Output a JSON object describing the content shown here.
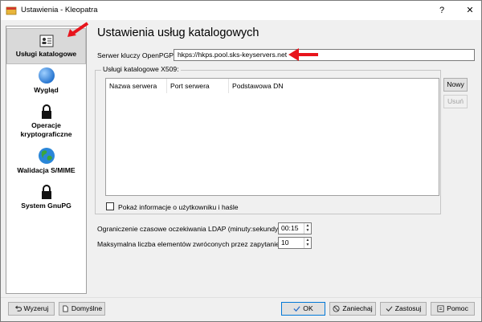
{
  "window": {
    "title": "Ustawienia - Kleopatra",
    "help_glyph": "?",
    "close_glyph": "✕"
  },
  "sidebar": {
    "items": [
      {
        "label": "Usługi katalogowe",
        "icon": "directory-services-icon",
        "active": true
      },
      {
        "label": "Wygląd",
        "icon": "appearance-globe-icon"
      },
      {
        "label": "Operacje kryptograficzne",
        "icon": "lock-icon"
      },
      {
        "label": "Walidacja S/MIME",
        "icon": "earth-globe-icon"
      },
      {
        "label": "System GnuPG",
        "icon": "lock-icon"
      }
    ]
  },
  "main": {
    "title": "Ustawienia usług katalogowych",
    "openpgp_label": "Serwer kluczy OpenPGP:",
    "openpgp_value": "hkps://hkps.pool.sks-keyservers.net",
    "x509_group_title": "Usługi katalogowe X509:",
    "table_headers": [
      "Nazwa serwera",
      "Port serwera",
      "Podstawowa DN"
    ],
    "new_button": "Nowy",
    "remove_button": "Usuń",
    "show_user_info_label": "Pokaż informacje o użytkowniku i haśle",
    "ldap_timeout_label": "Ograniczenie czasowe oczekiwania LDAP (minuty:sekundy):",
    "ldap_timeout_value": "00:15",
    "max_items_label": "Maksymalna liczba elementów zwróconych przez zapytanie:",
    "max_items_value": "10"
  },
  "footer": {
    "reset_label": "Wyzeruj",
    "defaults_label": "Domyślne",
    "ok_label": "OK",
    "cancel_label": "Zaniechaj",
    "apply_label": "Zastosuj",
    "help_label": "Pomoc"
  },
  "colors": {
    "annotation_arrow": "#e8141c",
    "globe_blue": "#2f8be0",
    "earth_green": "#3aa53a"
  }
}
